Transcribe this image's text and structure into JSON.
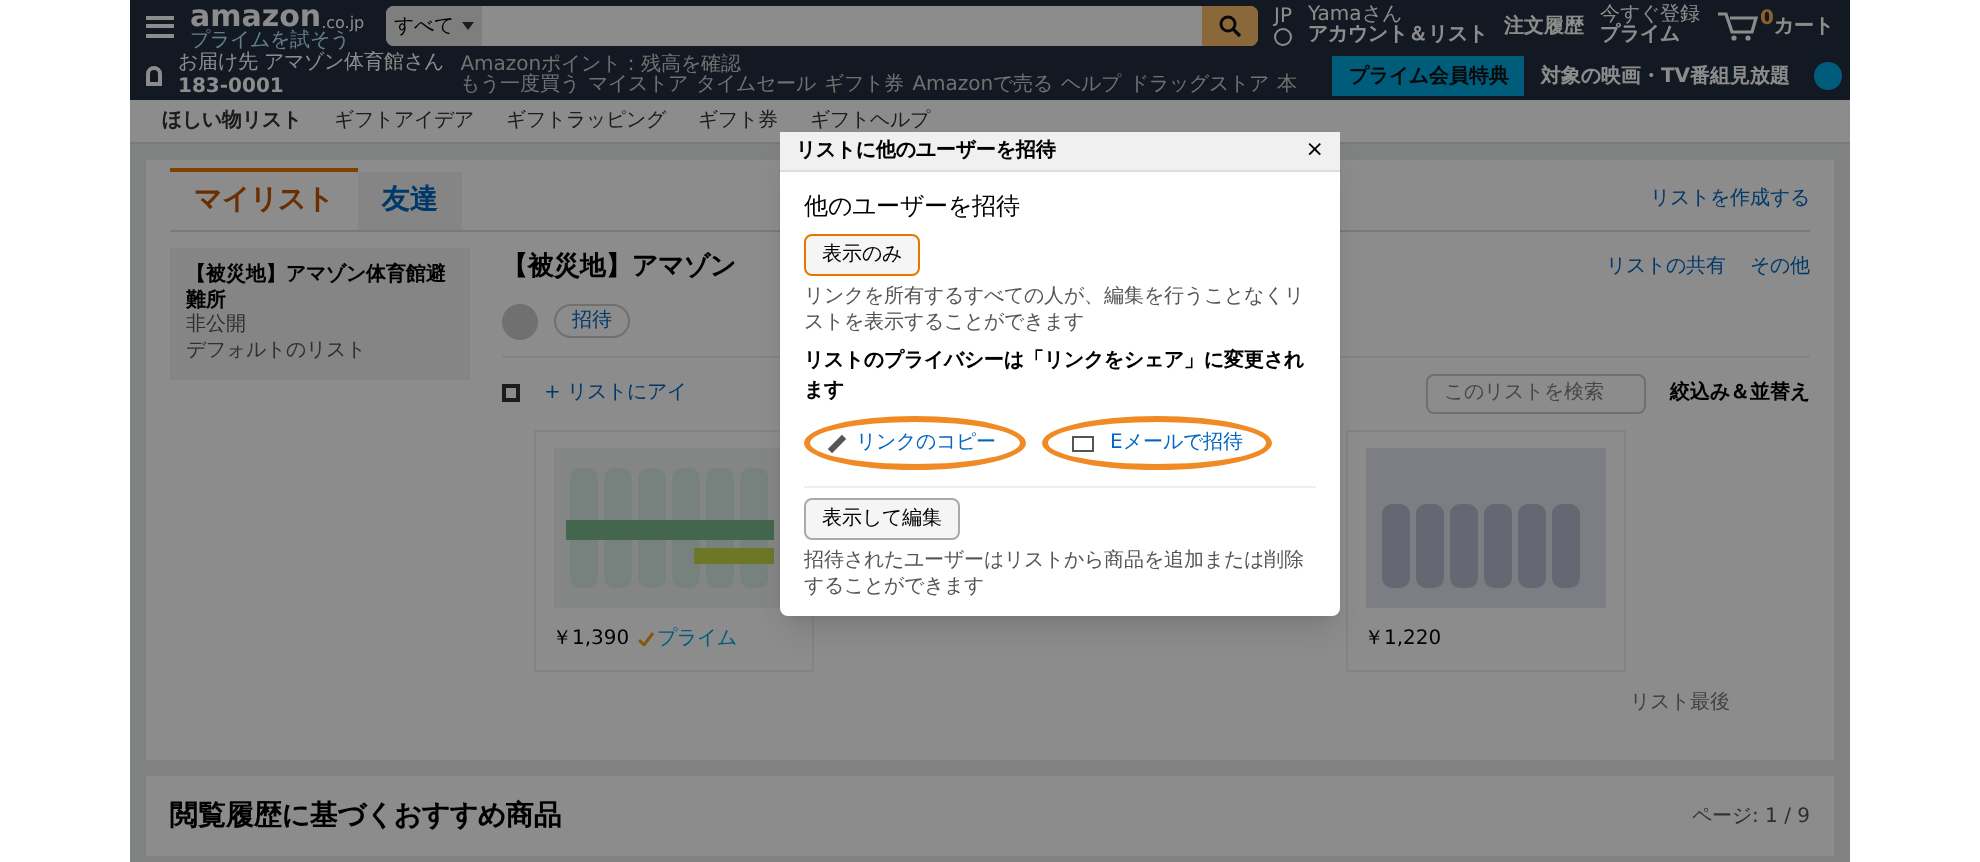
{
  "header": {
    "logo": "amazon",
    "logo_suffix": ".co.jp",
    "logo_tagline": "プライムを試そう",
    "search_scope": "すべて",
    "language": "JP",
    "greeting": "Yamaさん",
    "account": "アカウント＆リスト",
    "orders": "注文履歴",
    "prime_top": "今すぐ登録",
    "prime": "プライム",
    "cart_count": "0",
    "cart": "カート",
    "deliver_to": "お届け先 アマゾン体育館さん",
    "postcode": "183-0001",
    "points": "Amazonポイント：残高を確認",
    "nav_links": [
      "もう一度買う",
      "マイストア",
      "タイムセール",
      "ギフト券",
      "Amazonで売る",
      "ヘルプ",
      "ドラッグストア",
      "本"
    ],
    "prime_banner": "プライム会員特典",
    "prime_promo": "対象の映画・TV番組見放題"
  },
  "subnav": [
    "ほしい物リスト",
    "ギフトアイデア",
    "ギフトラッピング",
    "ギフト券",
    "ギフトヘルプ"
  ],
  "tabs": [
    {
      "label": "マイリスト",
      "selected": true
    },
    {
      "label": "友達",
      "selected": false
    }
  ],
  "create_list": "リストを作成する",
  "sidebar_list": {
    "title": "【被災地】アマゾン体育館避難所",
    "badge": "非公開",
    "subtitle": "デフォルトのリスト"
  },
  "list": {
    "title": "【被災地】アマゾン",
    "invite": "招待",
    "share": "リストの共有",
    "more": "その他",
    "add_item": "+ リストにアイ",
    "search_placeholder": "このリストを検索",
    "filter": "絞込み＆並替え",
    "items": [
      {
        "price": "￥1,390",
        "prime": "プライム"
      },
      {
        "price": "￥1,220"
      }
    ],
    "end": "リスト最後"
  },
  "recommend": {
    "title": "閲覧履歴に基づくおすすめ商品",
    "page": "ページ: 1 / 9"
  },
  "dialog": {
    "title": "リストに他のユーザーを招待",
    "close": "×",
    "heading": "他のユーザーを招待",
    "view_button": "表示のみ",
    "view_text": "リンクを所有するすべての人が、編集を行うことなくリストを表示することができます",
    "privacy": "リストのプライバシーは「リンクをシェア」に変更されます",
    "links": [
      {
        "kind": "copy",
        "label": "リンクのコピー",
        "circled": true
      },
      {
        "kind": "email",
        "label": "Eメールで招待",
        "circled": true
      }
    ],
    "edit_button": "表示して編集",
    "edit_text": "招待されたユーザーはリストから商品を追加または削除することができます"
  }
}
